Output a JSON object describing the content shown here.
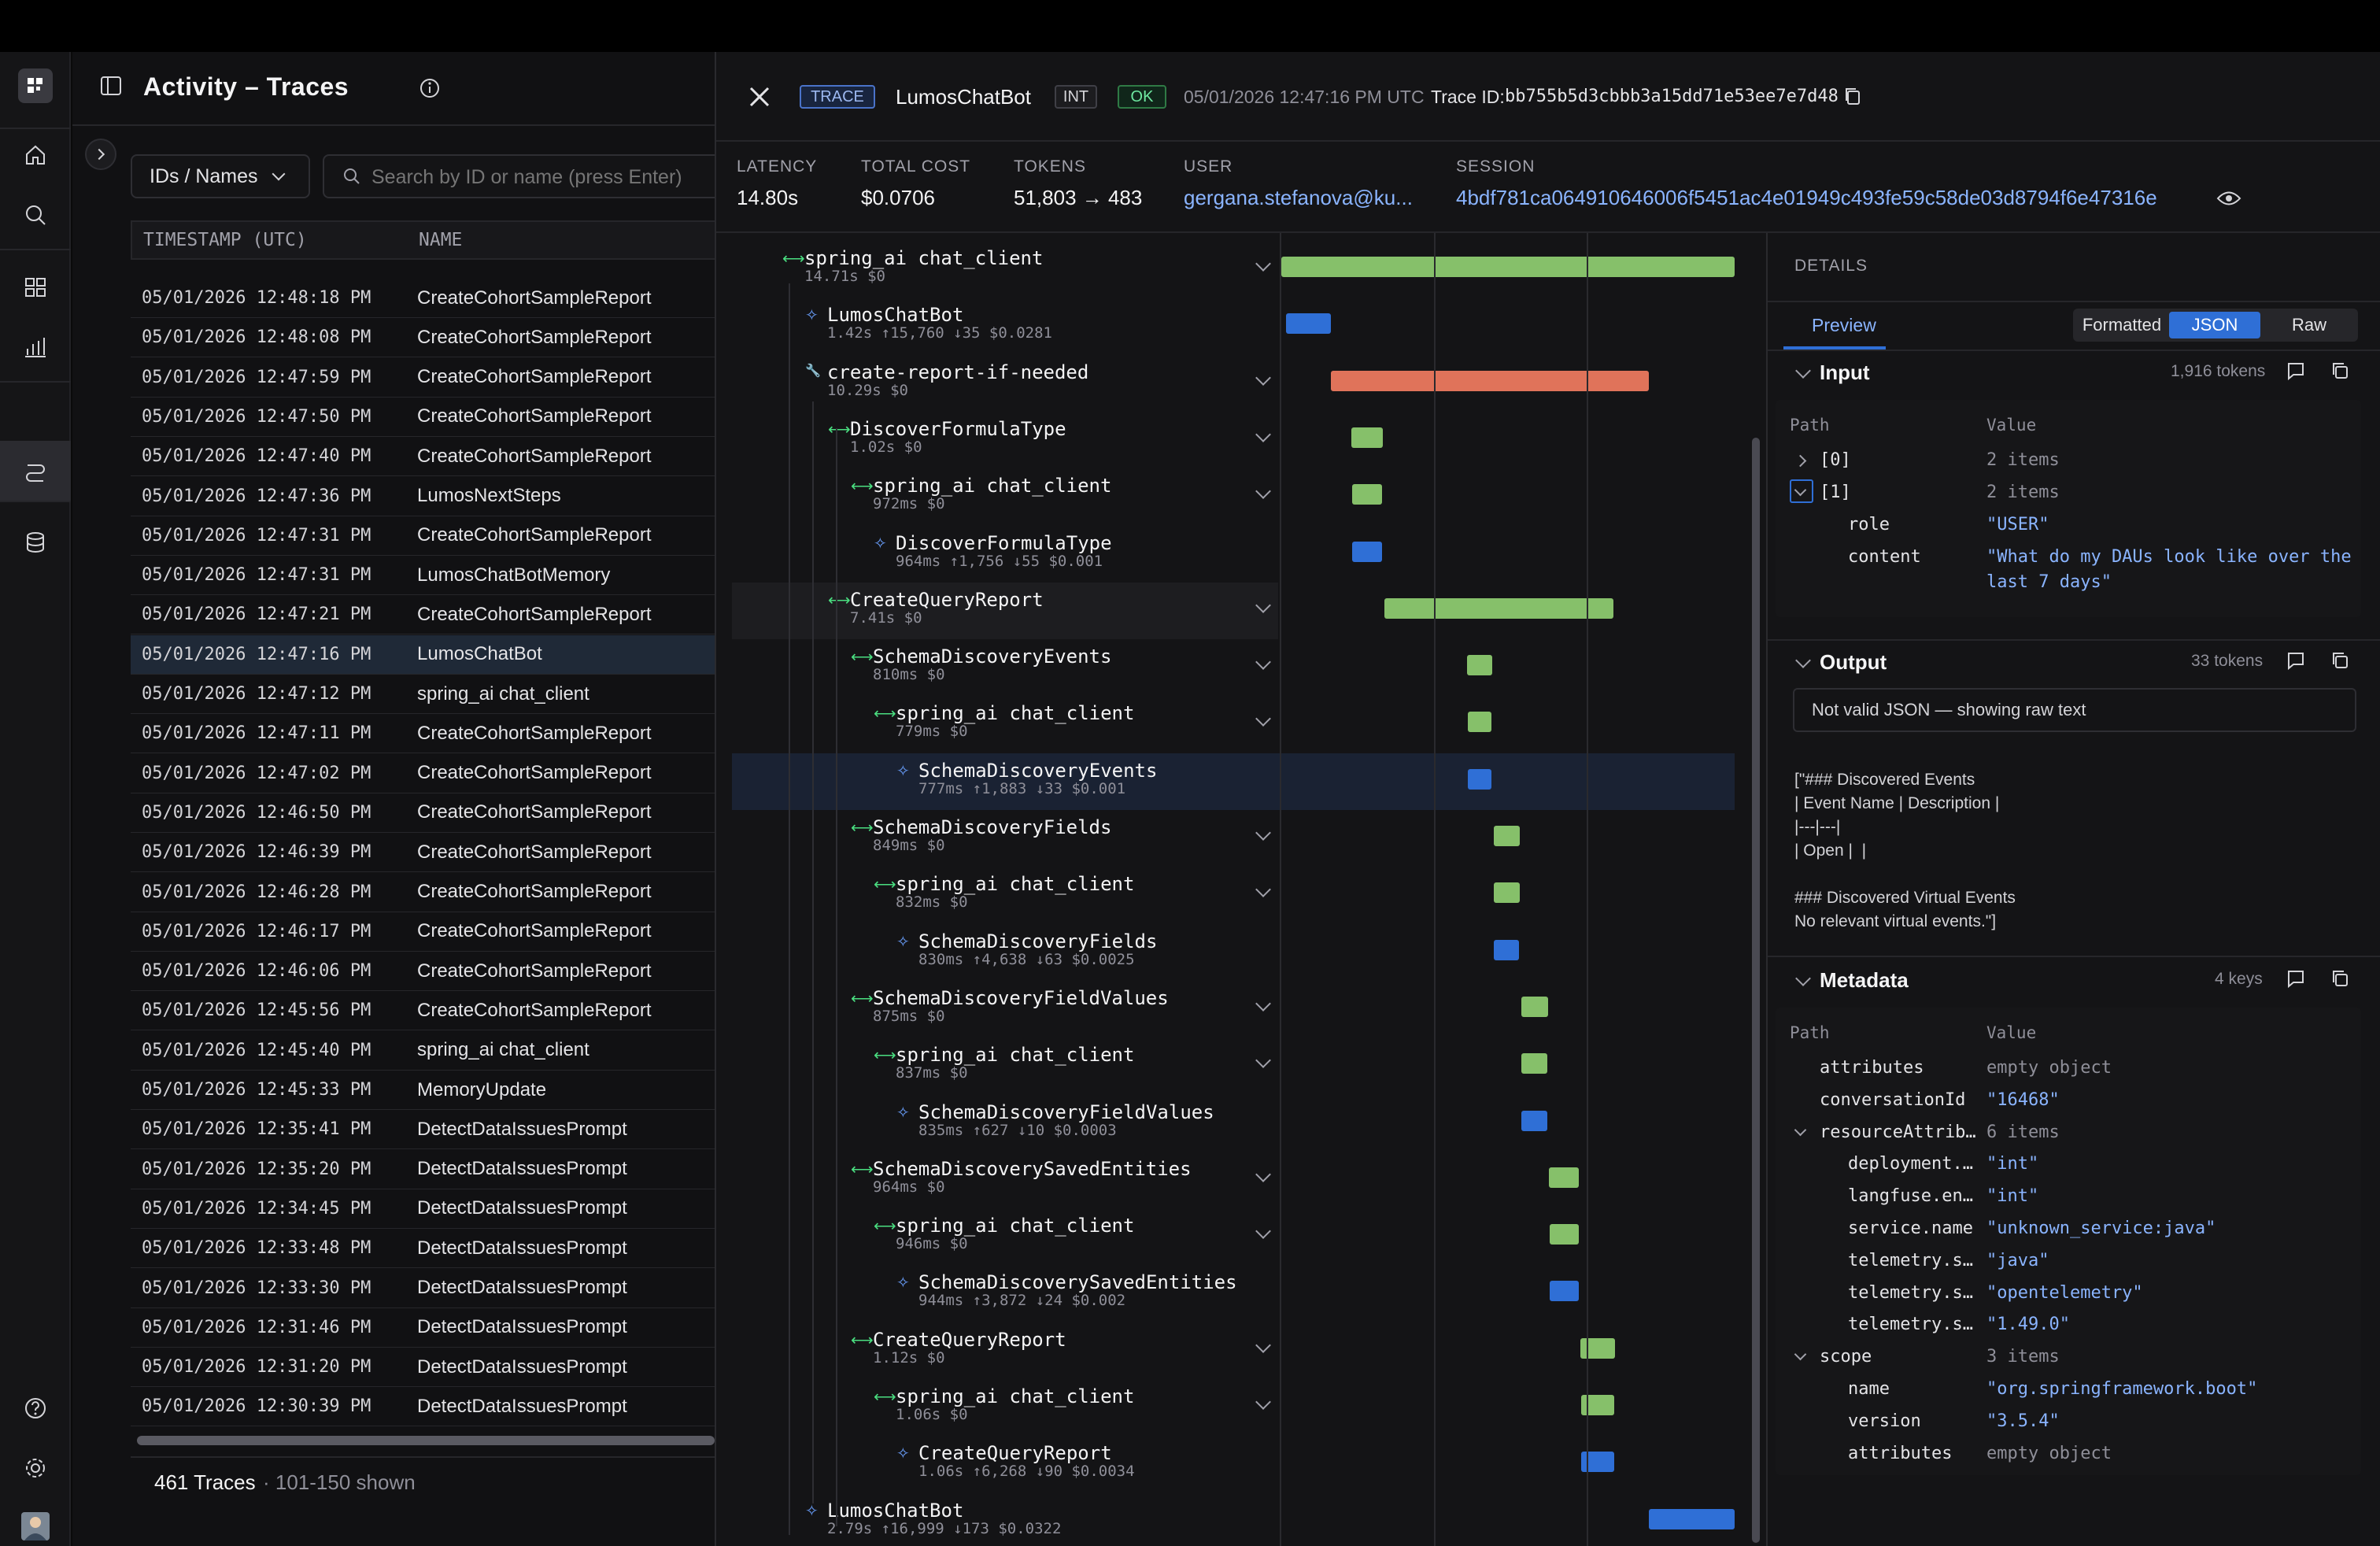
{
  "header": {
    "title": "Activity – Traces",
    "filter_label": "IDs / Names",
    "search_placeholder": "Search by ID or name (press Enter)"
  },
  "table": {
    "columns": [
      "TIMESTAMP (UTC)",
      "NAME"
    ],
    "rows": [
      [
        "05/01/2026 12:48:18 PM",
        "CreateCohortSampleReport"
      ],
      [
        "05/01/2026 12:48:08 PM",
        "CreateCohortSampleReport"
      ],
      [
        "05/01/2026 12:47:59 PM",
        "CreateCohortSampleReport"
      ],
      [
        "05/01/2026 12:47:50 PM",
        "CreateCohortSampleReport"
      ],
      [
        "05/01/2026 12:47:40 PM",
        "CreateCohortSampleReport"
      ],
      [
        "05/01/2026 12:47:36 PM",
        "LumosNextSteps"
      ],
      [
        "05/01/2026 12:47:31 PM",
        "CreateCohortSampleReport"
      ],
      [
        "05/01/2026 12:47:31 PM",
        "LumosChatBotMemory"
      ],
      [
        "05/01/2026 12:47:21 PM",
        "CreateCohortSampleReport"
      ],
      [
        "05/01/2026 12:47:16 PM",
        "LumosChatBot"
      ],
      [
        "05/01/2026 12:47:12 PM",
        "spring_ai chat_client"
      ],
      [
        "05/01/2026 12:47:11 PM",
        "CreateCohortSampleReport"
      ],
      [
        "05/01/2026 12:47:02 PM",
        "CreateCohortSampleReport"
      ],
      [
        "05/01/2026 12:46:50 PM",
        "CreateCohortSampleReport"
      ],
      [
        "05/01/2026 12:46:39 PM",
        "CreateCohortSampleReport"
      ],
      [
        "05/01/2026 12:46:28 PM",
        "CreateCohortSampleReport"
      ],
      [
        "05/01/2026 12:46:17 PM",
        "CreateCohortSampleReport"
      ],
      [
        "05/01/2026 12:46:06 PM",
        "CreateCohortSampleReport"
      ],
      [
        "05/01/2026 12:45:56 PM",
        "CreateCohortSampleReport"
      ],
      [
        "05/01/2026 12:45:40 PM",
        "spring_ai chat_client"
      ],
      [
        "05/01/2026 12:45:33 PM",
        "MemoryUpdate"
      ],
      [
        "05/01/2026 12:35:41 PM",
        "DetectDataIssuesPrompt"
      ],
      [
        "05/01/2026 12:35:20 PM",
        "DetectDataIssuesPrompt"
      ],
      [
        "05/01/2026 12:34:45 PM",
        "DetectDataIssuesPrompt"
      ],
      [
        "05/01/2026 12:33:48 PM",
        "DetectDataIssuesPrompt"
      ],
      [
        "05/01/2026 12:33:30 PM",
        "DetectDataIssuesPrompt"
      ],
      [
        "05/01/2026 12:31:46 PM",
        "DetectDataIssuesPrompt"
      ],
      [
        "05/01/2026 12:31:20 PM",
        "DetectDataIssuesPrompt"
      ],
      [
        "05/01/2026 12:30:39 PM",
        "DetectDataIssuesPrompt"
      ]
    ],
    "selected_index": 9,
    "footer_count": "461 Traces",
    "footer_shown": "· 101-150 shown"
  },
  "trace": {
    "type_badge": "TRACE",
    "name": "LumosChatBot",
    "env_badge": "INT",
    "status_badge": "OK",
    "timestamp": "05/01/2026 12:47:16 PM UTC",
    "trace_id_label": "Trace ID:",
    "trace_id": "bb755b5d3cbbb3a15dd71e53ee7e7d48",
    "stats": {
      "latency_label": "LATENCY",
      "latency": "14.80s",
      "cost_label": "TOTAL COST",
      "cost": "$0.0706",
      "tokens_label": "TOKENS",
      "tokens": "51,803 → 483",
      "user_label": "USER",
      "user": "gergana.stefanova@ku...",
      "session_label": "SESSION",
      "session": "4bdf781ca064910646006f5451ac4e01949c493fe59c58de03d8794f6e47316e"
    },
    "spans": [
      {
        "name": "spring_ai chat_client",
        "meta": "14.71s $0",
        "depth": 0,
        "kind": "chain",
        "start": 0.0,
        "width": 1.0,
        "color": "g"
      },
      {
        "name": "LumosChatBot",
        "meta": "1.42s ↑15,760 ↓35 $0.0281",
        "depth": 1,
        "kind": "gen",
        "start": 0.01,
        "width": 0.1,
        "color": "b"
      },
      {
        "name": "create-report-if-needed",
        "meta": "10.29s $0",
        "depth": 1,
        "kind": "tool",
        "start": 0.11,
        "width": 0.7,
        "color": "o"
      },
      {
        "name": "DiscoverFormulaType",
        "meta": "1.02s $0",
        "depth": 2,
        "kind": "chain",
        "start": 0.155,
        "width": 0.069,
        "color": "g"
      },
      {
        "name": "spring_ai chat_client",
        "meta": "972ms $0",
        "depth": 3,
        "kind": "chain",
        "start": 0.157,
        "width": 0.066,
        "color": "g"
      },
      {
        "name": "DiscoverFormulaType",
        "meta": "964ms ↑1,756 ↓55 $0.001",
        "depth": 4,
        "kind": "gen",
        "start": 0.157,
        "width": 0.065,
        "color": "b"
      },
      {
        "name": "CreateQueryReport",
        "meta": "7.41s $0",
        "depth": 2,
        "kind": "chain",
        "start": 0.228,
        "width": 0.504,
        "color": "g"
      },
      {
        "name": "SchemaDiscoveryEvents",
        "meta": "810ms $0",
        "depth": 3,
        "kind": "chain",
        "start": 0.41,
        "width": 0.055,
        "color": "g"
      },
      {
        "name": "spring_ai chat_client",
        "meta": "779ms $0",
        "depth": 4,
        "kind": "chain",
        "start": 0.411,
        "width": 0.053,
        "color": "g"
      },
      {
        "name": "SchemaDiscoveryEvents",
        "meta": "777ms ↑1,883 ↓33 $0.001",
        "depth": 5,
        "kind": "gen",
        "start": 0.411,
        "width": 0.053,
        "color": "b"
      },
      {
        "name": "SchemaDiscoveryFields",
        "meta": "849ms $0",
        "depth": 3,
        "kind": "chain",
        "start": 0.468,
        "width": 0.058,
        "color": "g"
      },
      {
        "name": "spring_ai chat_client",
        "meta": "832ms $0",
        "depth": 4,
        "kind": "chain",
        "start": 0.469,
        "width": 0.057,
        "color": "g"
      },
      {
        "name": "SchemaDiscoveryFields",
        "meta": "830ms ↑4,638 ↓63 $0.0025",
        "depth": 5,
        "kind": "gen",
        "start": 0.469,
        "width": 0.056,
        "color": "b"
      },
      {
        "name": "SchemaDiscoveryFieldValues",
        "meta": "875ms $0",
        "depth": 3,
        "kind": "chain",
        "start": 0.529,
        "width": 0.059,
        "color": "g"
      },
      {
        "name": "spring_ai chat_client",
        "meta": "837ms $0",
        "depth": 4,
        "kind": "chain",
        "start": 0.53,
        "width": 0.057,
        "color": "g"
      },
      {
        "name": "SchemaDiscoveryFieldValues",
        "meta": "835ms ↑627 ↓10 $0.0003",
        "depth": 5,
        "kind": "gen",
        "start": 0.53,
        "width": 0.057,
        "color": "b"
      },
      {
        "name": "SchemaDiscoverySavedEntities",
        "meta": "964ms $0",
        "depth": 3,
        "kind": "chain",
        "start": 0.591,
        "width": 0.066,
        "color": "g"
      },
      {
        "name": "spring_ai chat_client",
        "meta": "946ms $0",
        "depth": 4,
        "kind": "chain",
        "start": 0.592,
        "width": 0.064,
        "color": "g"
      },
      {
        "name": "SchemaDiscoverySavedEntities",
        "meta": "944ms ↑3,872 ↓24 $0.002",
        "depth": 5,
        "kind": "gen",
        "start": 0.592,
        "width": 0.064,
        "color": "b"
      },
      {
        "name": "CreateQueryReport",
        "meta": "1.12s $0",
        "depth": 3,
        "kind": "chain",
        "start": 0.66,
        "width": 0.076,
        "color": "g"
      },
      {
        "name": "spring_ai chat_client",
        "meta": "1.06s $0",
        "depth": 4,
        "kind": "chain",
        "start": 0.662,
        "width": 0.072,
        "color": "g"
      },
      {
        "name": "CreateQueryReport",
        "meta": "1.06s ↑6,268 ↓90 $0.0034",
        "depth": 5,
        "kind": "gen",
        "start": 0.662,
        "width": 0.072,
        "color": "b"
      },
      {
        "name": "LumosChatBot",
        "meta": "2.79s ↑16,999 ↓173 $0.0322",
        "depth": 1,
        "kind": "gen",
        "start": 0.81,
        "width": 0.19,
        "color": "b"
      }
    ]
  },
  "details": {
    "heading": "DETAILS",
    "tabs": {
      "preview": "Preview",
      "formatted": "Formatted",
      "json": "JSON",
      "raw": "Raw"
    },
    "input": {
      "title": "Input",
      "tokens": "1,916 tokens",
      "col_path": "Path",
      "col_value": "Value",
      "rows": [
        {
          "path": "[0]",
          "value": "2 items",
          "indent": 0,
          "kind": "muted",
          "toggle": "closed"
        },
        {
          "path": "[1]",
          "value": "2 items",
          "indent": 0,
          "kind": "muted",
          "toggle": "open"
        },
        {
          "path": "role",
          "value": "\"USER\"",
          "indent": 1,
          "kind": "str"
        },
        {
          "path": "content",
          "value": "\"What do my DAUs look like over the",
          "value2": "last 7 days\"",
          "indent": 1,
          "kind": "str"
        }
      ]
    },
    "output": {
      "title": "Output",
      "tokens": "33 tokens",
      "notice": "Not valid JSON — showing raw text",
      "raw": "[\"### Discovered Events\n| Event Name | Description |\n|---|---|\n| Open |  |\n\n### Discovered Virtual Events\nNo relevant virtual events.\"]"
    },
    "metadata": {
      "title": "Metadata",
      "tokens": "4 keys",
      "col_path": "Path",
      "col_value": "Value",
      "rows": [
        {
          "path": "attributes",
          "value": "empty object",
          "indent": 0,
          "kind": "muted"
        },
        {
          "path": "conversationId",
          "value": "\"16468\"",
          "indent": 0,
          "kind": "str"
        },
        {
          "path": "resourceAttrib…",
          "value": "6 items",
          "indent": 0,
          "kind": "muted",
          "toggle": "open"
        },
        {
          "path": "deployment.…",
          "value": "\"int\"",
          "indent": 1,
          "kind": "str"
        },
        {
          "path": "langfuse.en…",
          "value": "\"int\"",
          "indent": 1,
          "kind": "str"
        },
        {
          "path": "service.name",
          "value": "\"unknown_service:java\"",
          "indent": 1,
          "kind": "str"
        },
        {
          "path": "telemetry.s…",
          "value": "\"java\"",
          "indent": 1,
          "kind": "str"
        },
        {
          "path": "telemetry.s…",
          "value": "\"opentelemetry\"",
          "indent": 1,
          "kind": "str"
        },
        {
          "path": "telemetry.s…",
          "value": "\"1.49.0\"",
          "indent": 1,
          "kind": "str"
        },
        {
          "path": "scope",
          "value": "3 items",
          "indent": 0,
          "kind": "muted",
          "toggle": "open"
        },
        {
          "path": "name",
          "value": "\"org.springframework.boot\"",
          "indent": 1,
          "kind": "str"
        },
        {
          "path": "version",
          "value": "\"3.5.4\"",
          "indent": 1,
          "kind": "str"
        },
        {
          "path": "attributes",
          "value": "empty object",
          "indent": 1,
          "kind": "muted"
        }
      ]
    }
  },
  "colors": {
    "accent": "#2f6fd6",
    "green": "#86c06a",
    "orange": "#e0735a",
    "link": "#8ab4ff",
    "ok": "#4ade80"
  }
}
